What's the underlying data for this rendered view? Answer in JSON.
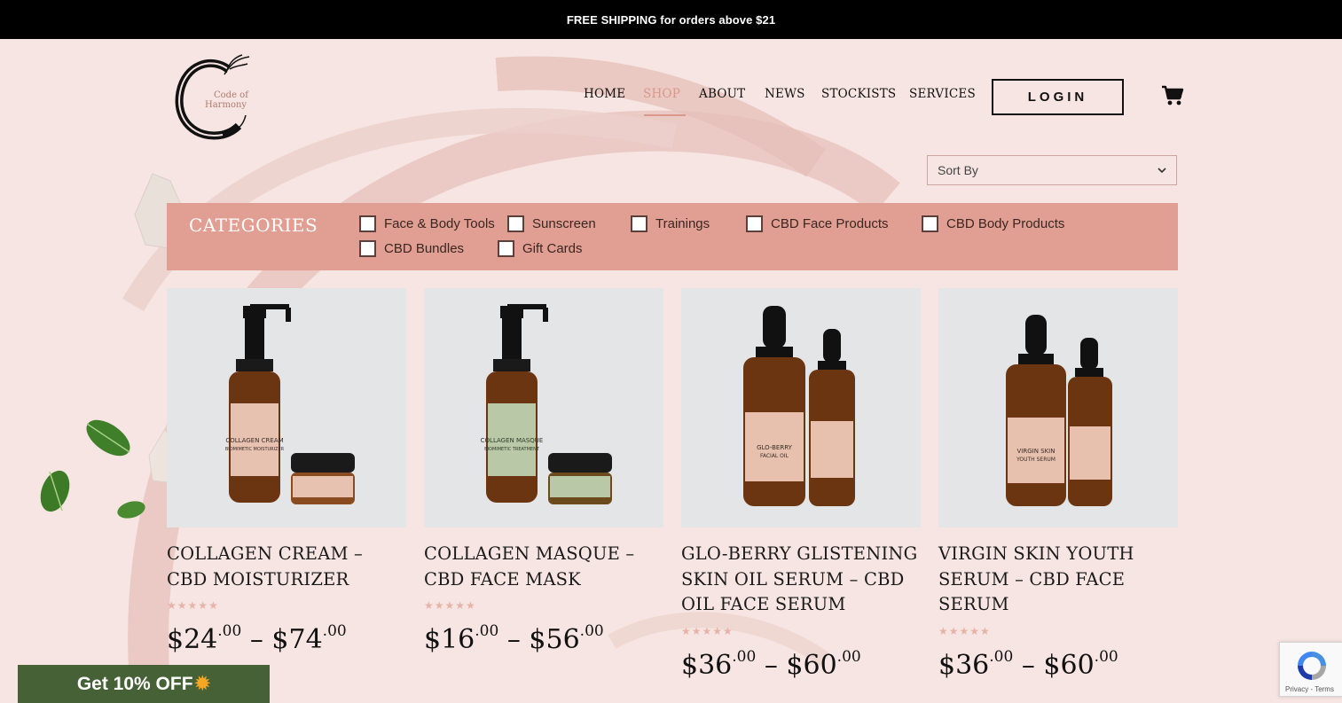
{
  "banner": {
    "text": "FREE SHIPPING for orders above $21"
  },
  "brand": {
    "line1": "Code of",
    "line2": "Harmony"
  },
  "nav": {
    "items": [
      {
        "label": "HOME",
        "active": false
      },
      {
        "label": "SHOP",
        "active": true
      },
      {
        "label": "ABOUT",
        "active": false
      },
      {
        "label": "NEWS",
        "active": false
      },
      {
        "label": "STOCKISTS",
        "active": false
      },
      {
        "label": "SERVICES",
        "active": false
      }
    ],
    "login_label": "LOGIN",
    "accent_color": "#d9988a"
  },
  "sort": {
    "selected": "Sort By"
  },
  "categories": {
    "title": "CATEGORIES",
    "items": [
      {
        "label": "Face & Body Tools",
        "checked": false
      },
      {
        "label": "Sunscreen",
        "checked": false
      },
      {
        "label": "Trainings",
        "checked": false
      },
      {
        "label": "CBD Face Products",
        "checked": false
      },
      {
        "label": "CBD Body Products",
        "checked": false
      },
      {
        "label": "CBD Bundles",
        "checked": false
      },
      {
        "label": "Gift Cards",
        "checked": false
      }
    ],
    "background_color": "#e09f92"
  },
  "products": [
    {
      "name": "COLLAGEN CREAM – CBD MOISTURIZER",
      "rating": 0,
      "price_min": {
        "whole": "$24",
        "cents": ".00"
      },
      "price_max": {
        "whole": "$74",
        "cents": ".00"
      },
      "separator": "–",
      "label_text": [
        "COLLAGEN CREAM",
        "BIOMIMETIC MOISTURIZER"
      ],
      "label_color": "#e9c2b0"
    },
    {
      "name": "COLLAGEN MASQUE – CBD FACE MASK",
      "rating": 0,
      "price_min": {
        "whole": "$16",
        "cents": ".00"
      },
      "price_max": {
        "whole": "$56",
        "cents": ".00"
      },
      "separator": "–",
      "label_text": [
        "COLLAGEN MASQUE",
        "BIOMIMETIC TREATMENT"
      ],
      "label_color": "#b9c9a7"
    },
    {
      "name": "GLO-BERRY GLISTENING SKIN OIL SERUM – CBD OIL FACE SERUM",
      "rating": 0,
      "price_min": {
        "whole": "$36",
        "cents": ".00"
      },
      "price_max": {
        "whole": "$60",
        "cents": ".00"
      },
      "separator": "–",
      "label_text": [
        "GLO-BERRY",
        "FACIAL OIL"
      ],
      "label_color": "#e7c1ad"
    },
    {
      "name": "VIRGIN SKIN YOUTH SERUM – CBD FACE SERUM",
      "rating": 0,
      "price_min": {
        "whole": "$36",
        "cents": ".00"
      },
      "price_max": {
        "whole": "$60",
        "cents": ".00"
      },
      "separator": "–",
      "label_text": [
        "VIRGIN SKIN",
        "YOUTH SERUM"
      ],
      "label_color": "#e7c1ad"
    }
  ],
  "promo": {
    "label": "Get 10% OFF",
    "icon": "sun-icon"
  },
  "recaptcha": {
    "terms": "Privacy - Terms"
  }
}
